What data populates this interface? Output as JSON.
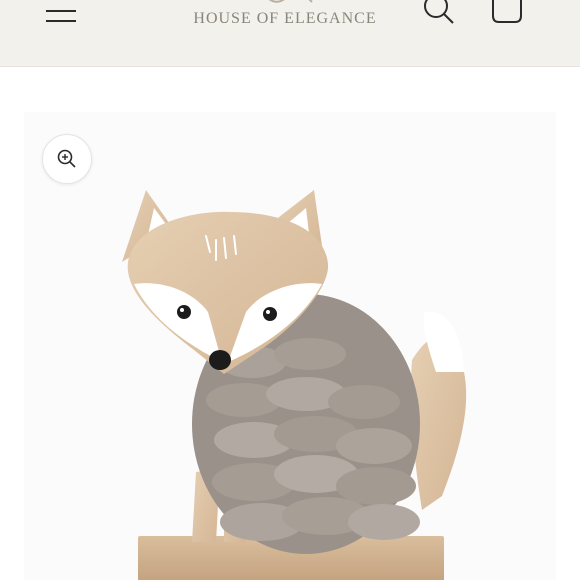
{
  "header": {
    "logo_script": "Aurelia",
    "logo_text": "HOUSE OF ELEGANCE",
    "icons": {
      "menu": "menu-icon",
      "search": "search-icon",
      "cart": "shopping-bag-icon"
    }
  },
  "product_media": {
    "image": "wooden-fox-figurine-with-grey-wool-body",
    "zoom_icon": "zoom-in-icon"
  },
  "colors": {
    "header_bg": "#f3f1ec",
    "logo_text": "#8a857a",
    "icon": "#2b2b2b"
  }
}
